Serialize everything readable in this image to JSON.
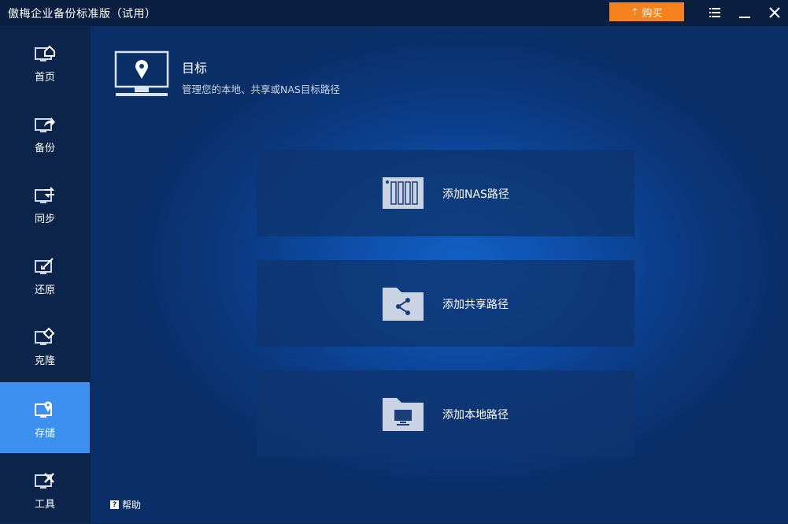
{
  "window": {
    "title": "傲梅企业备份标准版（试用）",
    "buy_label": "购买",
    "accent": "#f5821f"
  },
  "sidebar": {
    "items": [
      {
        "label": "首页",
        "icon": "home-icon"
      },
      {
        "label": "备份",
        "icon": "backup-icon"
      },
      {
        "label": "同步",
        "icon": "sync-icon"
      },
      {
        "label": "还原",
        "icon": "restore-icon"
      },
      {
        "label": "克隆",
        "icon": "clone-icon"
      },
      {
        "label": "存储",
        "icon": "storage-icon",
        "active": true
      },
      {
        "label": "工具",
        "icon": "tools-icon"
      }
    ],
    "active_color": "#3d8ff0"
  },
  "help": {
    "label": "帮助"
  },
  "main": {
    "title": "目标",
    "subtitle": "管理您的本地、共享或NAS目标路径",
    "cards": [
      {
        "label": "添加NAS路径",
        "icon": "nas-icon"
      },
      {
        "label": "添加共享路径",
        "icon": "share-folder-icon"
      },
      {
        "label": "添加本地路径",
        "icon": "local-folder-icon"
      }
    ]
  }
}
